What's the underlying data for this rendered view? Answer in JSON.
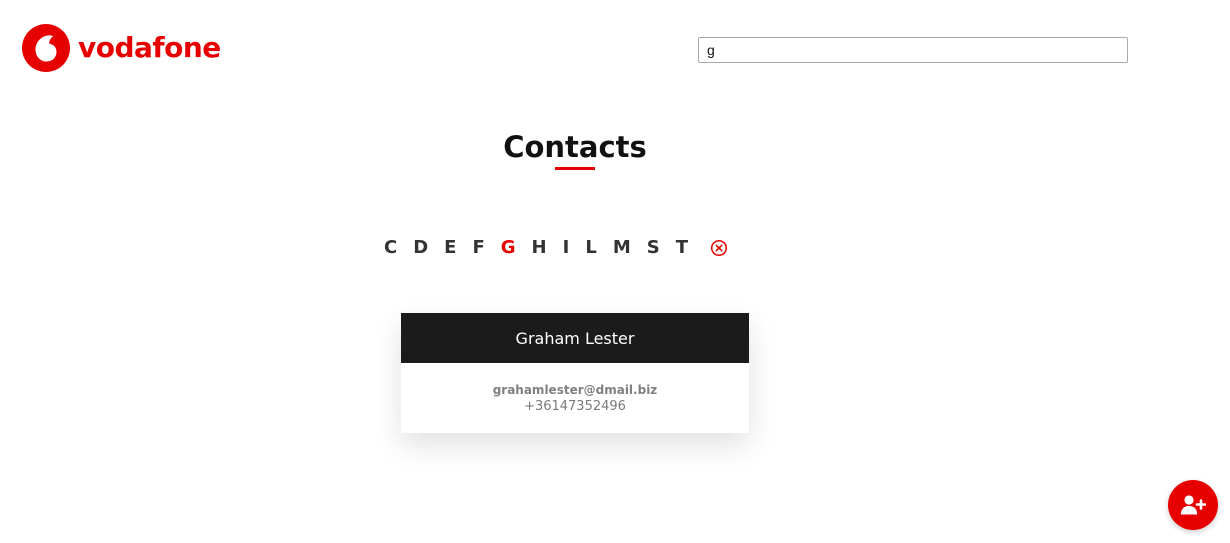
{
  "header": {
    "brand_name": "vodafone",
    "brand_color": "#e60000",
    "logo_icon": "vodafone-speechmark-icon"
  },
  "search": {
    "value": "g",
    "placeholder": ""
  },
  "main": {
    "title": "Contacts",
    "accent_color": "#e60000"
  },
  "filter": {
    "letters": [
      "C",
      "D",
      "E",
      "F",
      "G",
      "H",
      "I",
      "L",
      "M",
      "S",
      "T"
    ],
    "active_letter": "G",
    "clear_icon": "clear-filter-icon"
  },
  "contacts": [
    {
      "name": "Graham Lester",
      "email": "grahamlester@dmail.biz",
      "phone": "+36147352496"
    }
  ],
  "fab": {
    "icon": "add-user-icon",
    "color": "#e60000"
  }
}
